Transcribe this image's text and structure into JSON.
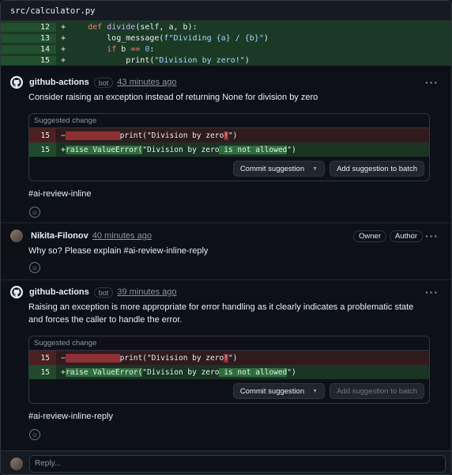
{
  "file": {
    "path": "src/calculator.py"
  },
  "diff": {
    "lines": [
      {
        "num": "12",
        "sign": "+",
        "code_parts": [
          [
            "    ",
            ""
          ],
          [
            "def",
            "kw"
          ],
          [
            " ",
            ""
          ],
          [
            "divide",
            "fn"
          ],
          [
            "(self, a, b):",
            ""
          ]
        ]
      },
      {
        "num": "13",
        "sign": "+",
        "code_parts": [
          [
            "        log_message(",
            ""
          ],
          [
            "f\"Dividing {a} / {b}\"",
            "str"
          ],
          [
            ")",
            ""
          ]
        ]
      },
      {
        "num": "14",
        "sign": "+",
        "code_parts": [
          [
            "        ",
            ""
          ],
          [
            "if",
            "kw"
          ],
          [
            " b ",
            ""
          ],
          [
            "==",
            "kw"
          ],
          [
            " ",
            ""
          ],
          [
            "0",
            "num"
          ],
          [
            ":",
            ""
          ]
        ]
      },
      {
        "num": "15",
        "sign": "+",
        "code_parts": [
          [
            "            print(",
            ""
          ],
          [
            "\"Division by zero!\"",
            "str"
          ],
          [
            ")",
            ""
          ]
        ]
      }
    ]
  },
  "comments": [
    {
      "author": "github-actions",
      "badge": "bot",
      "time": "43 minutes ago",
      "body": "Consider raising an exception instead of returning None for division by zero",
      "suggestion": {
        "title": "Suggested change",
        "del_num": "15",
        "del_sign": "−",
        "del_code_pre": "            ",
        "del_code_main": "print(\"Division by zero",
        "del_code_hl": "!",
        "del_code_post": "\")",
        "add_num": "15",
        "add_sign": "+",
        "add_code_hl1": "raise ValueError(",
        "add_code_mid": "\"Division by zero",
        "add_code_hl2": " is not allowed",
        "add_code_post": "\")",
        "commit_label": "Commit suggestion",
        "batch_label": "Add suggestion to batch"
      },
      "tag": "#ai-review-inline"
    },
    {
      "author": "Nikita-Filonov",
      "time": "40 minutes ago",
      "roles": [
        "Owner",
        "Author"
      ],
      "body": "Why so? Please explain #ai-review-inline-reply"
    },
    {
      "author": "github-actions",
      "badge": "bot",
      "time": "39 minutes ago",
      "body": "Raising an exception is more appropriate for error handling as it clearly indicates a problematic state and forces the caller to handle the error.",
      "suggestion": {
        "title": "Suggested change",
        "del_num": "15",
        "del_sign": "−",
        "del_code_pre": "            ",
        "del_code_main": "print(\"Division by zero",
        "del_code_hl": "!",
        "del_code_post": "\")",
        "add_num": "15",
        "add_sign": "+",
        "add_code_hl1": "raise ValueError(",
        "add_code_mid": "\"Division by zero",
        "add_code_hl2": " is not allowed",
        "add_code_post": "\")",
        "commit_label": "Commit suggestion",
        "batch_label": "Add suggestion to batch"
      },
      "tag": "#ai-review-inline-reply"
    }
  ],
  "reply": {
    "placeholder": "Reply..."
  },
  "icons": {
    "more": "kebab-horizontal-icon",
    "emoji": "smiley-icon",
    "github": "github-mark-icon"
  }
}
